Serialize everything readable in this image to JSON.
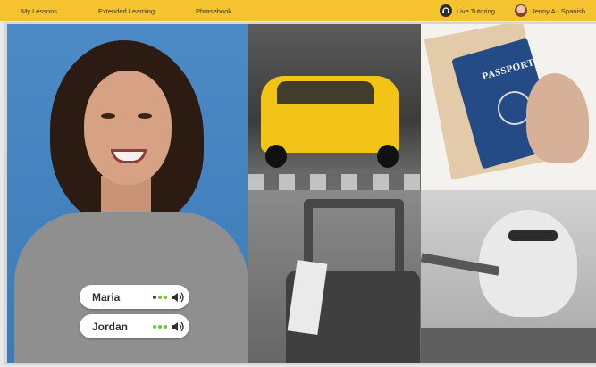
{
  "nav": {
    "items": [
      "My Lessons",
      "Extended Learning",
      "Phrasebook"
    ],
    "live_tutoring": "Live Tutoring",
    "user": "Jenny A - Spanish"
  },
  "images": [
    {
      "name": "woman-portrait",
      "alt": "smiling woman"
    },
    {
      "name": "taxi-photo",
      "alt": "yellow taxi"
    },
    {
      "name": "passport-photo",
      "alt": "passport"
    },
    {
      "name": "luggage-photo",
      "alt": "suitcase"
    },
    {
      "name": "airplane-photo",
      "alt": "airplane"
    }
  ],
  "passport_text": "PASSPORT",
  "speakers": [
    {
      "name": "Maria",
      "status": "speaking"
    },
    {
      "name": "Jordan",
      "status": "speaking"
    }
  ],
  "colors": {
    "topbar": "#f4c32f",
    "accent_green": "#6fc53c"
  },
  "icons": [
    "headset-icon",
    "avatar",
    "speaker-icon",
    "audio-dots-icon"
  ]
}
